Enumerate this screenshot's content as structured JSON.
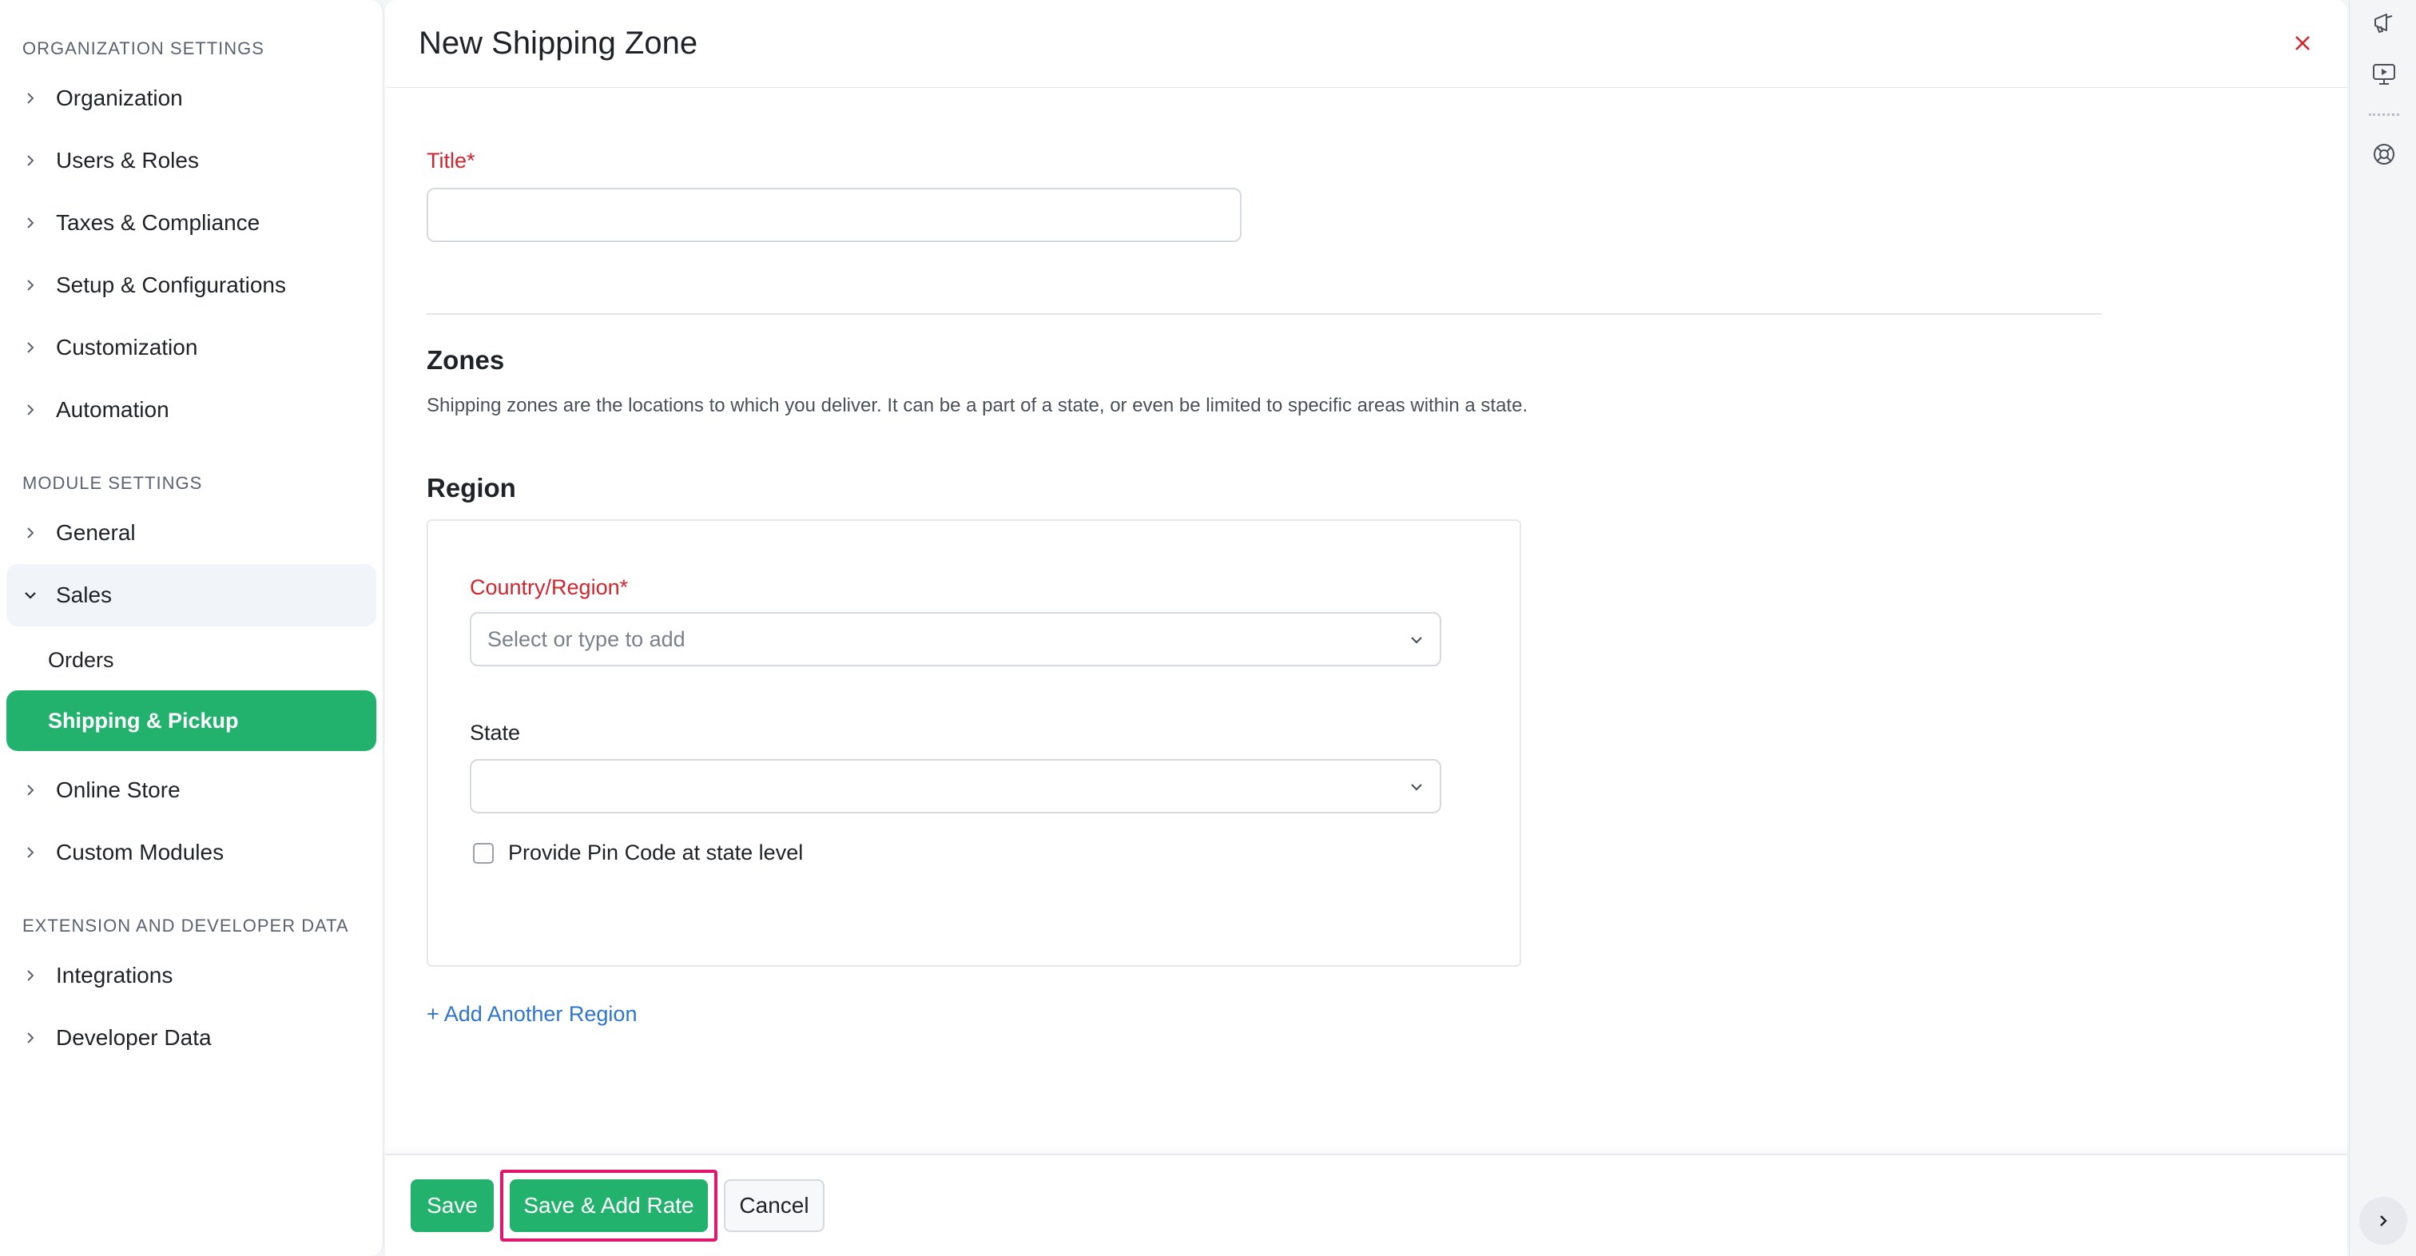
{
  "sidebar": {
    "sections": [
      {
        "header": "ORGANIZATION SETTINGS",
        "items": [
          "Organization",
          "Users & Roles",
          "Taxes & Compliance",
          "Setup & Configurations",
          "Customization",
          "Automation"
        ]
      },
      {
        "header": "MODULE SETTINGS",
        "items": [
          "General",
          "Sales",
          "Online Store",
          "Custom Modules"
        ],
        "sales_sub_items": [
          "Orders",
          "Shipping & Pickup"
        ]
      },
      {
        "header": "EXTENSION AND DEVELOPER DATA",
        "items": [
          "Integrations",
          "Developer Data"
        ]
      }
    ],
    "active_item": "Shipping & Pickup"
  },
  "main": {
    "title": "New Shipping Zone",
    "title_field": {
      "label": "Title*",
      "value": "",
      "placeholder": ""
    },
    "zones": {
      "heading": "Zones",
      "description": "Shipping zones are the locations to which you deliver. It can be a part of a state, or even be limited to specific areas within a state."
    },
    "region": {
      "heading": "Region",
      "country_label": "Country/Region*",
      "country_placeholder": "Select or type to add",
      "state_label": "State",
      "state_value": "",
      "pin_code_checkbox": "Provide Pin Code at state level",
      "pin_code_checked": false
    },
    "add_region_link": "+ Add Another Region"
  },
  "footer": {
    "save": "Save",
    "save_add_rate": "Save & Add Rate",
    "cancel": "Cancel"
  },
  "colors": {
    "accent_green": "#23b26d",
    "required_red": "#d1252f",
    "link_blue": "#2f74d0",
    "highlight_pink": "#e3166d"
  },
  "icons": {
    "close": "close-icon",
    "rail_top": "megaphone-icon",
    "rail_second": "video-tutorial-icon",
    "rail_third": "help-lifebuoy-icon",
    "expand": "chevron-right-icon"
  }
}
